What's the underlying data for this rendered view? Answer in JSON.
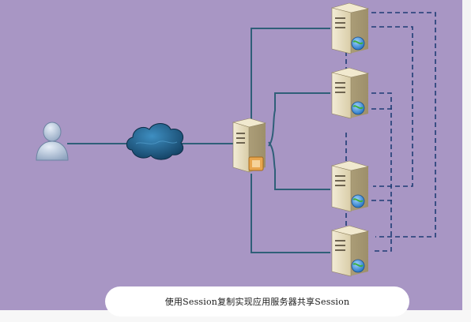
{
  "caption": "使用Session复制实现应用服务器共享Session",
  "colors": {
    "background": "#a896c4",
    "line": "#2f5f78",
    "dashed_line": "#1e3c75",
    "cloud": "#1d5f8a",
    "user": "#aebfd4",
    "server": "#e6dcc0"
  },
  "nodes": {
    "user": "user-icon",
    "cloud": "cloud-icon",
    "load_balancer": "server-with-lock-icon",
    "app_servers": [
      "server-globe-icon",
      "server-globe-icon",
      "server-globe-icon",
      "server-globe-icon"
    ]
  }
}
